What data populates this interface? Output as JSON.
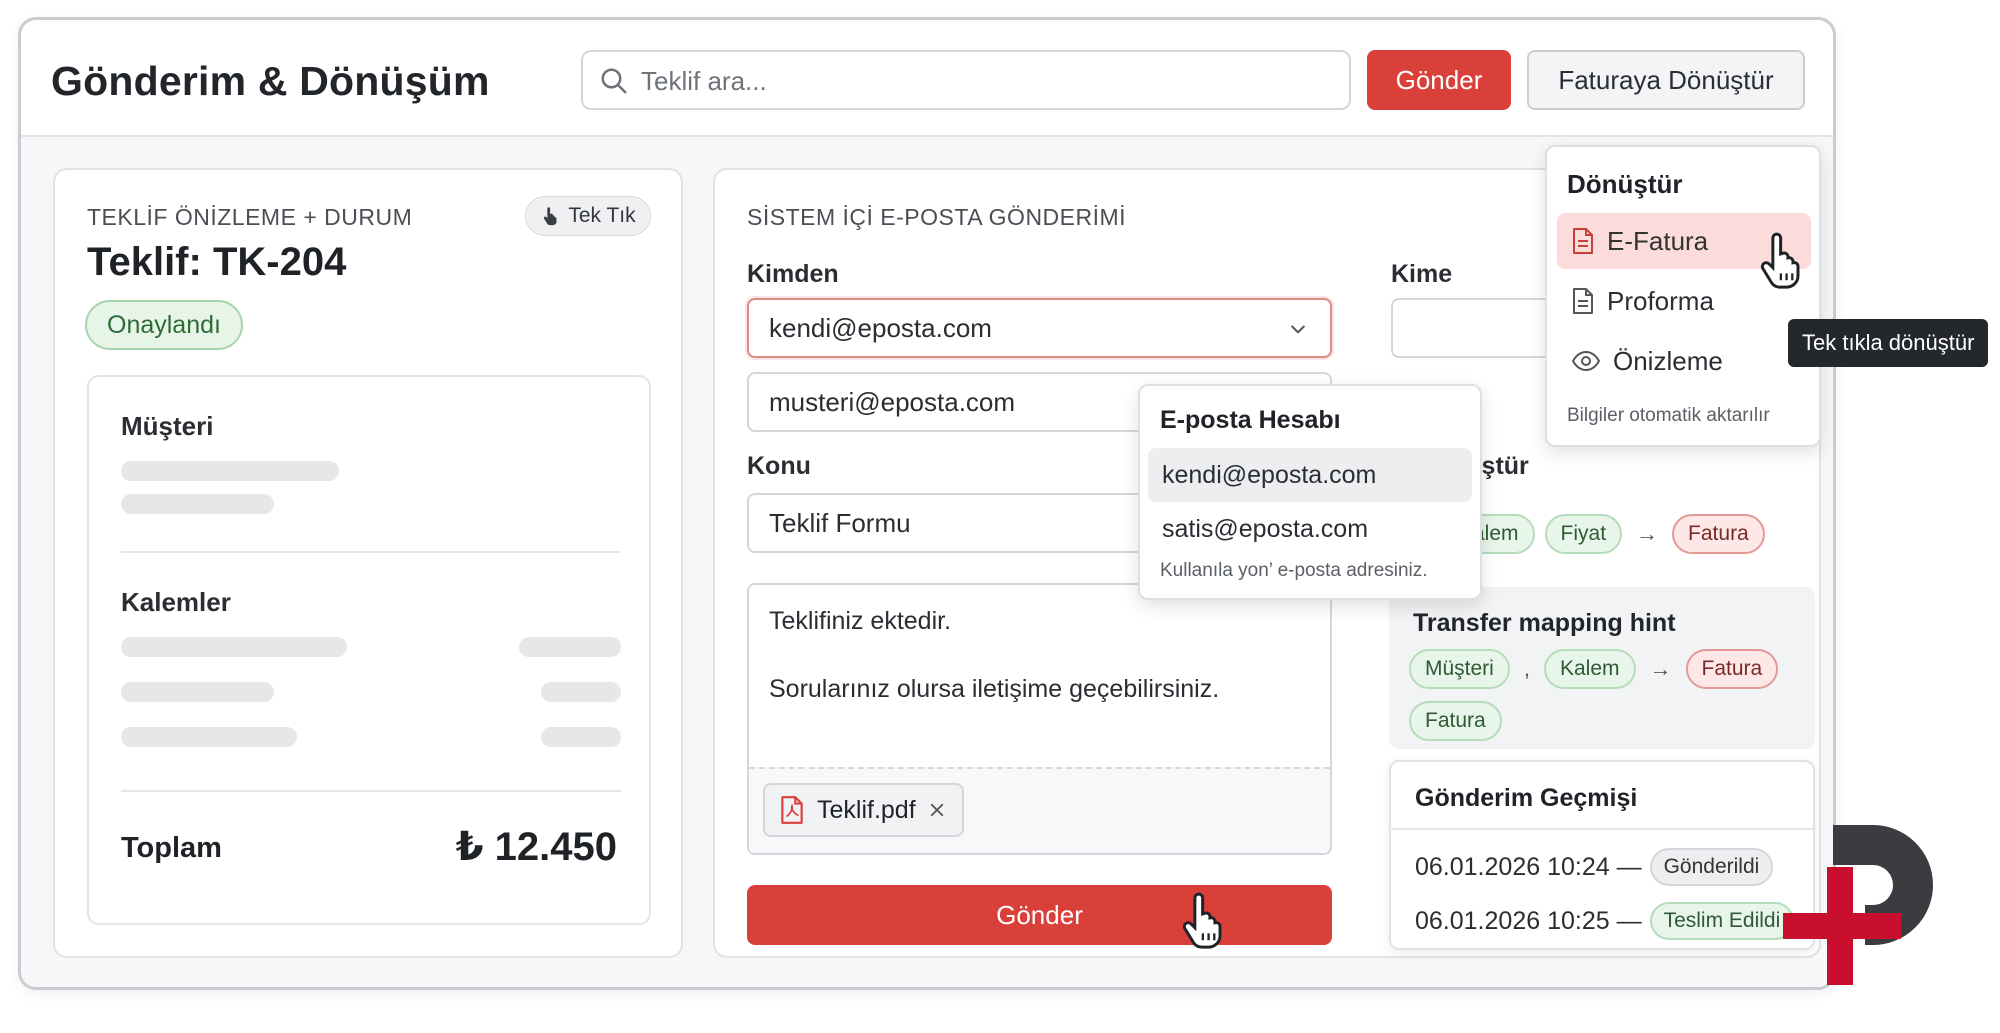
{
  "header": {
    "title": "Gönderim & Dönüşüm",
    "search_placeholder": "Teklif ara...",
    "send_label": "Gönder",
    "convert_label": "Faturaya Dönüştür"
  },
  "quote_panel": {
    "section_label": "TEKLİF ÖNİZLEME + DURUM",
    "one_click_label": "Tek Tık",
    "title": "Teklif: TK-204",
    "status": "Onaylandı",
    "customer_label": "Müşteri",
    "items_label": "Kalemler",
    "total_label": "Toplam",
    "total_value": "₺ 12.450"
  },
  "mail_panel": {
    "section_label": "SİSTEM İÇİ E-POSTA GÖNDERİMİ",
    "from_label": "Kimden",
    "from_value": "kendi@eposta.com",
    "to_label": "Kime",
    "to_value": "musteri@eposta.com",
    "subject_label": "Konu",
    "subject_value": "Teklif Formu",
    "body_line1": "Teklifiniz ektedir.",
    "body_line2": "Sorularınız olursa iletişime geçebilirsiniz.",
    "attachment": "Teklif.pdf",
    "send_label": "Gönder"
  },
  "account_dropdown": {
    "title": "E-posta Hesabı",
    "options": [
      "kendi@eposta.com",
      "satis@eposta.com"
    ],
    "hint": "Kullanıla yon’ e-posta adresiniz."
  },
  "mapping": {
    "partial_title": "nüştür",
    "row1": [
      "Kalem",
      "Fiyat",
      "Fatura"
    ],
    "hint_title": "Transfer mapping hint",
    "hint_chips": [
      "Müşteri",
      "Kalem",
      "Fatura",
      "Fatura"
    ],
    "comma": ","
  },
  "history": {
    "title": "Gönderim Geçmişi",
    "rows": [
      {
        "time": "06.01.2026 10:24 —",
        "status": "Gönderildi"
      },
      {
        "time": "06.01.2026 10:25 —",
        "status": "Teslim Edildi"
      }
    ]
  },
  "convert_dropdown": {
    "title": "Dönüştür",
    "items": [
      "E-Fatura",
      "Proforma",
      "Önizleme"
    ],
    "hint": "Bilgiler otomatik aktarılır",
    "tooltip": "Tek tıkla dönüştür"
  },
  "colors": {
    "accent_red": "#d9403a",
    "success_green": "#e8f5ea",
    "selected_red": "#fbdcda"
  }
}
